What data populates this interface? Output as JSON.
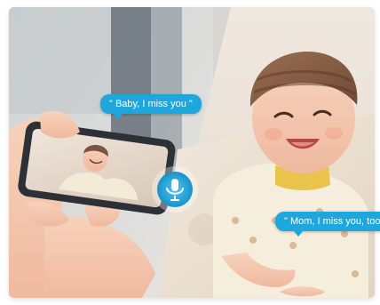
{
  "colors": {
    "bubble": "#1ea7dd",
    "bubble_text": "#ffffff",
    "mic": "#1fa3d8",
    "phone_body": "#2d3137"
  },
  "icons": {
    "mic": "microphone-icon"
  },
  "speech": {
    "parent": "\" Baby, I miss you \"",
    "baby": "\" Mom, I miss you, too \""
  }
}
